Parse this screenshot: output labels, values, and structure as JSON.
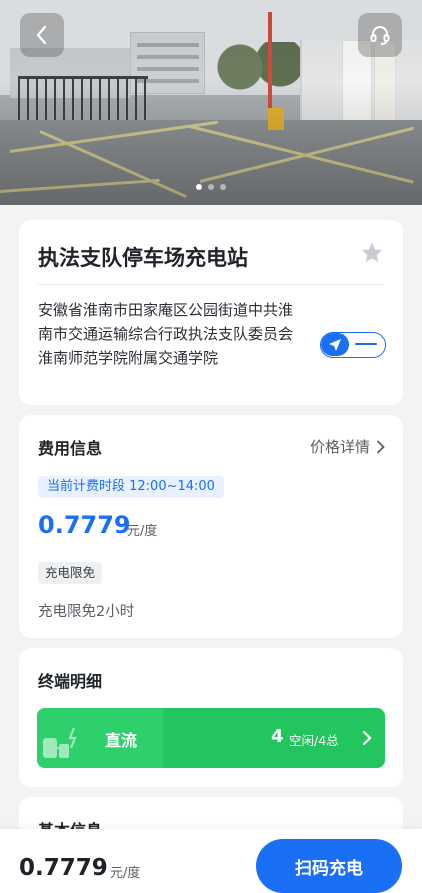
{
  "hero": {
    "dots_count": 3,
    "active_dot": 0
  },
  "station": {
    "name": "执法支队停车场充电站",
    "address": "安徽省淮南市田家庵区公园街道中共淮南市交通运输综合行政执法支队委员会淮南师范学院附属交通学院"
  },
  "fee": {
    "title": "费用信息",
    "price_detail_label": "价格详情",
    "current_period": "当前计费时段 12:00~14:00",
    "price": "0.7779",
    "unit": "元/度",
    "free_tag": "充电限免",
    "free_desc": "充电限免2小时"
  },
  "terminal": {
    "title": "终端明细",
    "type_label": "直流",
    "idle_count": "4",
    "status_text": "空闲/4总"
  },
  "basic": {
    "title": "基本信息"
  },
  "bottom": {
    "price": "0.7779",
    "unit": "元/度",
    "scan_label": "扫码充电"
  },
  "colors": {
    "accent": "#1a6ff5",
    "dc_green": "#22c55e",
    "background": "#f2f3f5"
  }
}
